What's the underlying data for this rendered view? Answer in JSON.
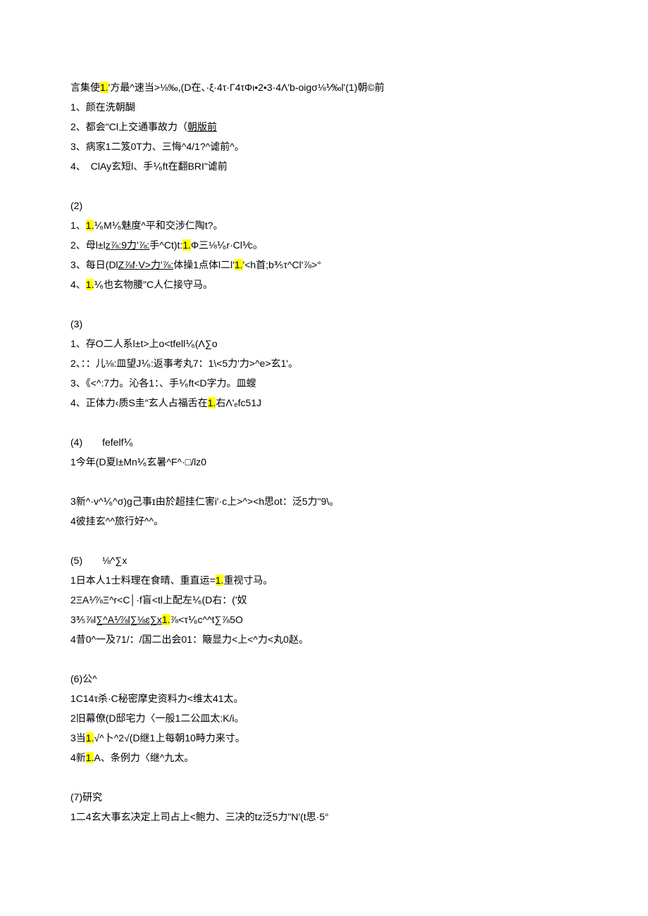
{
  "intro": {
    "pre": "言集使",
    "hl": "1.",
    "post": "'方最^速当>⅛‰,(D在、·ξ·4τ·Γ4τΦι•2•3·4Λ'b-oigσ⅛⅟‰l'(1)朝©前"
  },
  "sec1": {
    "l1": "1、颜在洗朝醐",
    "l2a": "2、都会\"Cl上交通事故力（",
    "l2u": "朝版前",
    "l3": "3、病家1二笈0T力、三悔^4/1?^谑前^。",
    "l4": "4、　ClAy玄短l、手⅟₆ft在翻BRI\"谑前"
  },
  "sec2": {
    "head": "(2)",
    "l1a": "1、",
    "l1hl": "1.",
    "l1b": "⅟₆M⅟₆魅度^平和交涉仁陶t?。",
    "l2a": "2、母l±l",
    "l2u": "z⅞:9力'⅞:",
    "l2b": "手^Ct)t:",
    "l2hl": "1.",
    "l2c": "Φ三⅛⅟₆r·Cl⅟c₀",
    "l3a": "3、每日(Dl",
    "l3u": "Z⅞f·V>力'⅞:",
    "l3b": "体操1点体l二l'",
    "l3hl": "1.",
    "l3c": "'<h首;b⅗τ^Cl'⅞>°",
    "l4a": "4、",
    "l4hl": "1.",
    "l4b": "⅟₆也玄物腰\"C人仁接守马。"
  },
  "sec3": {
    "head": "(3)",
    "l1": "1、存O二人系l±t>上o<tfell⅟₆(Λ∑o",
    "l2": "2、：：儿⅛:皿望J⅟₆:返事考丸7：1\\<5力'力>^e>玄1'。",
    "l3": "3、《<^:7力。沁各1：、手⅟₆ft<D字力。皿螋",
    "l4a": "4、正体力‹质S圭″玄人占福舌在",
    "l4hl": "1.",
    "l4b": "右Λ'ₑfc51J"
  },
  "sec4": {
    "head": "(4)　　fefelf⅟₆",
    "l1": "1今年(D夏l±Mn⅟₆玄暑^F^·□/lz0",
    "l3": "3新^·v^⅟₆^σ)g己事ɪ由於超挂仁害i'·c上>^><h思ot：泛5力\"9\\。",
    "l4": "4彼挂玄^^旅行好^^。"
  },
  "sec5": {
    "head": "(5)　　⅛^∑x",
    "l1a": "1日本人1士料理在食晴、重直运=",
    "l1hl": "1.",
    "l1b": "重视寸马。",
    "l2": "2ΞA⅟⅞Ξ^r<C│·f盲<tl上配左⅟₆(D右：('奴",
    "l3a": "3⅗⅞l",
    "l3u1": "∑^A⅟⅞l",
    "l3u2": "∑⅛ɛ",
    "l3u3": "∑x",
    "l3hl": "1.",
    "l3b": "⅞<τ⅟₆c^^t∑⅞5O",
    "l4": "4昔0^一及71/：/国二出会01：簸显力<上<^力<丸0赵。"
  },
  "sec6": {
    "head": "(6)公^",
    "l1": "1C14τ杀·C秘密摩史资料力<维太41太。",
    "l2": "2旧幕僚(D邸宅力〈一般1二公皿太:K/i。",
    "l3a": "3当",
    "l3hl": "1.",
    "l3b": "√^卜^2√(D继1上每朝10畤力来寸。",
    "l4a": "4新",
    "l4hl": "1.",
    "l4b": "A、条例力〈继^九太。"
  },
  "sec7": {
    "head": "(7)研究",
    "l1": "1二4玄大事玄决定上司占上<鲍力、三决的tz泛5力\"N'(t思·5°"
  }
}
